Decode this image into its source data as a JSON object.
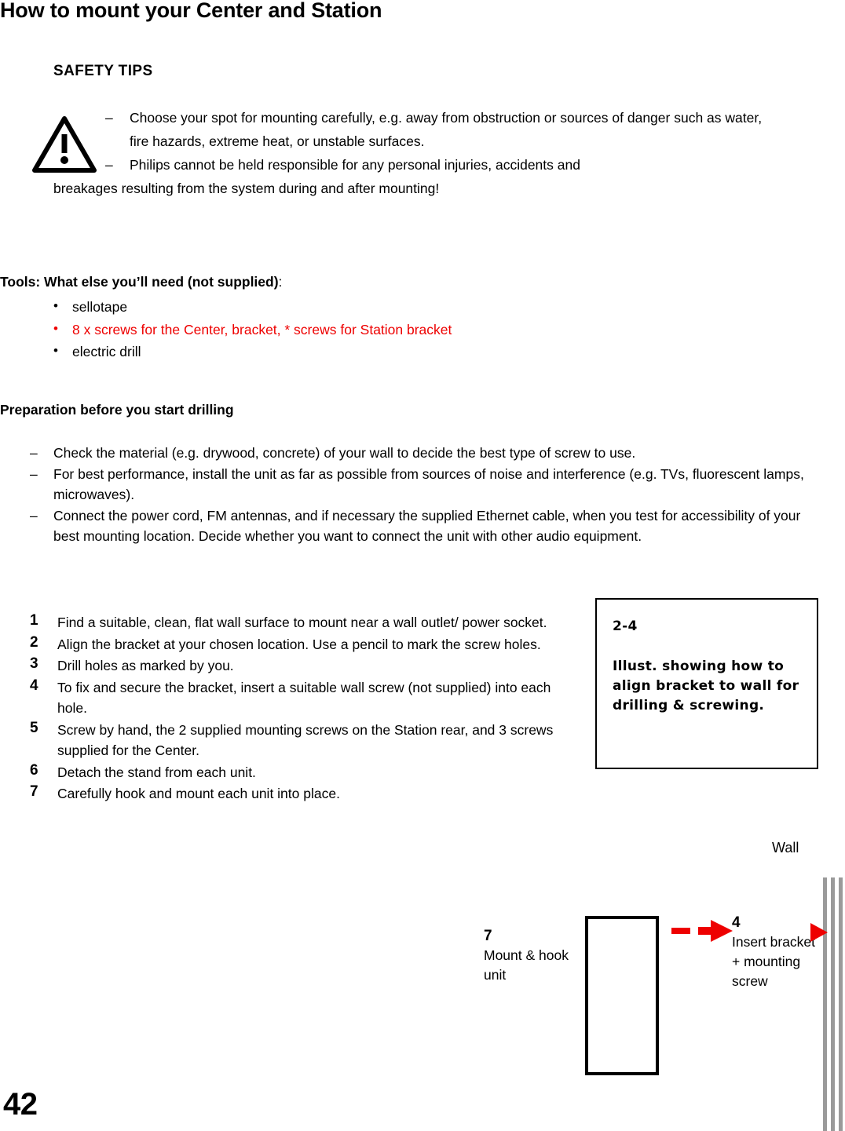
{
  "document": {
    "title": "How to mount your Center and Station",
    "page_number": "42"
  },
  "safety": {
    "heading": "SAFETY TIPS",
    "icon": "warning-triangle-icon",
    "dash": "–",
    "items": [
      "Choose your spot for mounting carefully, e.g. away from obstruction or sources of danger such as water, fire hazards, extreme heat, or unstable surfaces.",
      "Philips cannot be held responsible for any personal injuries, accidents and"
    ],
    "continuation": "breakages resulting from the system during and after mounting!"
  },
  "tools": {
    "heading_bold": "Tools: What else you’ll need  (not supplied)",
    "heading_tail": ":",
    "bullet": "•",
    "items": [
      {
        "text": "sellotape",
        "color": "#000000"
      },
      {
        "text": "8 x screws for the Center, bracket, * screws for Station bracket",
        "color": "#ee0000"
      },
      {
        "text": "electric drill",
        "color": "#000000"
      }
    ]
  },
  "preparation": {
    "heading": "Preparation before you start drilling",
    "dash": "–",
    "items": [
      "Check the material (e.g. drywood, concrete) of your wall to decide the best type of screw to use.",
      "For best performance, install the unit as far as possible from sources of noise and interference (e.g. TVs, fluorescent lamps, microwaves).",
      "Connect the power cord, FM antennas, and if necessary the supplied Ethernet cable, when you test for accessibility of your best mounting location. Decide whether you want to connect the unit with other audio equipment."
    ]
  },
  "steps": [
    {
      "num": "1",
      "text": "Find a suitable, clean, flat wall surface to mount near a wall outlet/ power socket."
    },
    {
      "num": "2",
      "text": "Align the bracket at your chosen location. Use a pencil to mark the screw holes."
    },
    {
      "num": "3",
      "text": "Drill holes as marked by you."
    },
    {
      "num": "4",
      "text": "To fix and secure the bracket, insert a suitable wall screw (not supplied) into each hole."
    },
    {
      "num": "5",
      "text": "Screw by hand, the 2 supplied mounting screws on the Station rear, and 3 screws supplied for the Center."
    },
    {
      "num": "6",
      "text": "Detach the stand from each unit."
    },
    {
      "num": "7",
      "text": "Carefully hook and mount each unit into place."
    }
  ],
  "illustration_box": {
    "code": "2-4",
    "description": "Illust. showing how to align bracket to wall for drilling & screwing."
  },
  "diagram": {
    "wall_label": "Wall",
    "mount_label": {
      "num": "7",
      "text": "Mount & hook unit"
    },
    "insert_label": {
      "num": "4",
      "text": "Insert bracket + mounting screw"
    },
    "unit_shape": "unit-rectangle",
    "arrow_color": "#ee0000",
    "wall_color": "#9a9a9a"
  }
}
